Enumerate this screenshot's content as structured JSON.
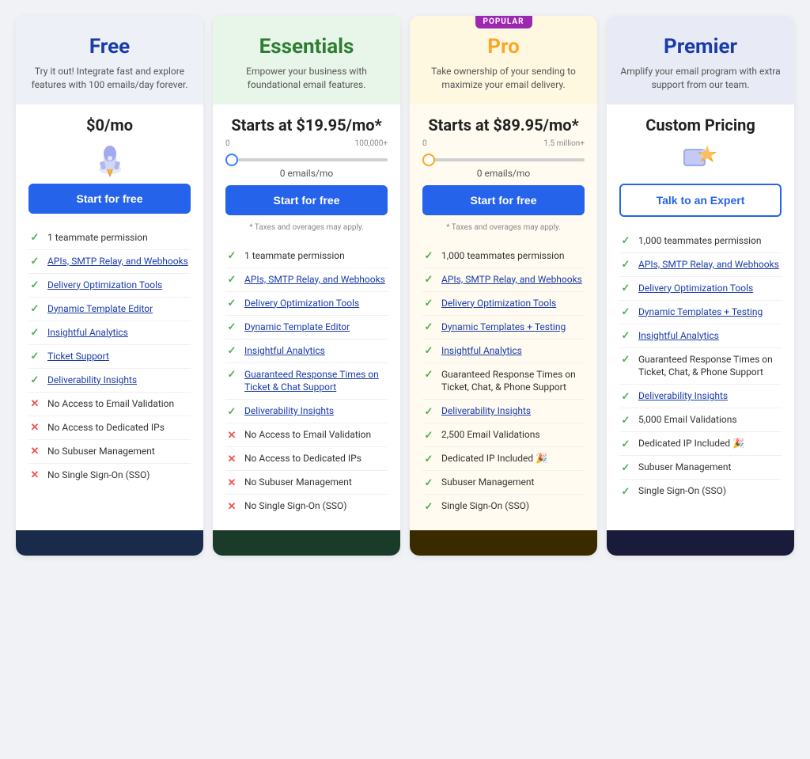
{
  "plans": [
    {
      "id": "free",
      "name": "Free",
      "nameColor": "#1a3caa",
      "headerBg": "#eef0f8",
      "desc": "Try it out! Integrate fast and explore features with 100 emails/day forever.",
      "price": "$0/mo",
      "hasSlider": false,
      "icon": "🚀",
      "iconType": "rocket",
      "ctaLabel": "Start for free",
      "ctaType": "primary",
      "taxNote": "",
      "popular": false,
      "footerBg": "#1a2a4a",
      "features": [
        {
          "check": true,
          "text": "1 teammate permission"
        },
        {
          "check": true,
          "text": "APIs, SMTP Relay, and Webhooks",
          "link": true
        },
        {
          "check": true,
          "text": "Delivery Optimization Tools",
          "link": true
        },
        {
          "check": true,
          "text": "Dynamic Template Editor",
          "link": true
        },
        {
          "check": true,
          "text": "Insightful Analytics",
          "link": true
        },
        {
          "check": true,
          "text": "Ticket Support",
          "link": true
        },
        {
          "check": true,
          "text": "Deliverability Insights",
          "link": true
        },
        {
          "check": false,
          "text": "No Access to Email Validation"
        },
        {
          "check": false,
          "text": "No Access to Dedicated IPs"
        },
        {
          "check": false,
          "text": "No Subuser Management"
        },
        {
          "check": false,
          "text": "No Single Sign-On (SSO)"
        }
      ]
    },
    {
      "id": "essentials",
      "name": "Essentials",
      "nameColor": "#2e7d32",
      "headerBg": "#e8f5e9",
      "desc": "Empower your business with foundational email features.",
      "price": "Starts at $19.95/mo*",
      "hasSlider": true,
      "sliderMin": "0",
      "sliderMax": "100,000+",
      "sliderValue": 0,
      "emailCount": "0 emails/mo",
      "icon": null,
      "iconType": null,
      "ctaLabel": "Start for free",
      "ctaType": "primary",
      "taxNote": "* Taxes and overages may apply.",
      "popular": false,
      "footerBg": "#1a3a2a",
      "features": [
        {
          "check": true,
          "text": "1 teammate permission"
        },
        {
          "check": true,
          "text": "APIs, SMTP Relay, and Webhooks",
          "link": true
        },
        {
          "check": true,
          "text": "Delivery Optimization Tools",
          "link": true
        },
        {
          "check": true,
          "text": "Dynamic Template Editor",
          "link": true
        },
        {
          "check": true,
          "text": "Insightful Analytics",
          "link": true
        },
        {
          "check": true,
          "text": "Guaranteed Response Times on Ticket & Chat Support",
          "link": true
        },
        {
          "check": true,
          "text": "Deliverability Insights",
          "link": true
        },
        {
          "check": false,
          "text": "No Access to Email Validation"
        },
        {
          "check": false,
          "text": "No Access to Dedicated IPs"
        },
        {
          "check": false,
          "text": "No Subuser Management"
        },
        {
          "check": false,
          "text": "No Single Sign-On (SSO)"
        }
      ]
    },
    {
      "id": "pro",
      "name": "Pro",
      "nameColor": "#f9a825",
      "headerBg": "#fff8e1",
      "desc": "Take ownership of your sending to maximize your email delivery.",
      "price": "Starts at $89.95/mo*",
      "hasSlider": true,
      "sliderMin": "0",
      "sliderMax": "1.5 million+",
      "sliderValue": 0,
      "emailCount": "0 emails/mo",
      "icon": null,
      "iconType": null,
      "ctaLabel": "Start for free",
      "ctaType": "primary",
      "taxNote": "* Taxes and overages may apply.",
      "popular": true,
      "popularLabel": "POPULAR",
      "footerBg": "#3a2a00",
      "features": [
        {
          "check": true,
          "text": "1,000 teammates permission"
        },
        {
          "check": true,
          "text": "APIs, SMTP Relay, and Webhooks",
          "link": true
        },
        {
          "check": true,
          "text": "Delivery Optimization Tools",
          "link": true
        },
        {
          "check": true,
          "text": "Dynamic Templates + Testing",
          "link": true
        },
        {
          "check": true,
          "text": "Insightful Analytics",
          "link": true
        },
        {
          "check": true,
          "text": "Guaranteed Response Times on Ticket, Chat, & Phone Support"
        },
        {
          "check": true,
          "text": "Deliverability Insights",
          "link": true
        },
        {
          "check": true,
          "text": "2,500 Email Validations"
        },
        {
          "check": true,
          "text": "Dedicated IP Included 🎉"
        },
        {
          "check": true,
          "text": "Subuser Management"
        },
        {
          "check": true,
          "text": "Single Sign-On (SSO)"
        }
      ]
    },
    {
      "id": "premier",
      "name": "Premier",
      "nameColor": "#1a3caa",
      "headerBg": "#e8eaf6",
      "desc": "Amplify your email program with extra support from our team.",
      "price": "Custom Pricing",
      "hasSlider": false,
      "icon": "⭐",
      "iconType": "star",
      "ctaLabel": "Talk to an Expert",
      "ctaType": "outline",
      "taxNote": "",
      "popular": false,
      "footerBg": "#1a1a3a",
      "features": [
        {
          "check": true,
          "text": "1,000 teammates permission"
        },
        {
          "check": true,
          "text": "APIs, SMTP Relay, and Webhooks",
          "link": true
        },
        {
          "check": true,
          "text": "Delivery Optimization Tools",
          "link": true
        },
        {
          "check": true,
          "text": "Dynamic Templates + Testing",
          "link": true
        },
        {
          "check": true,
          "text": "Insightful Analytics",
          "link": true
        },
        {
          "check": true,
          "text": "Guaranteed Response Times on Ticket, Chat, & Phone Support"
        },
        {
          "check": true,
          "text": "Deliverability Insights",
          "link": true
        },
        {
          "check": true,
          "text": "5,000 Email Validations"
        },
        {
          "check": true,
          "text": "Dedicated IP Included 🎉"
        },
        {
          "check": true,
          "text": "Subuser Management"
        },
        {
          "check": true,
          "text": "Single Sign-On (SSO)"
        }
      ]
    }
  ]
}
